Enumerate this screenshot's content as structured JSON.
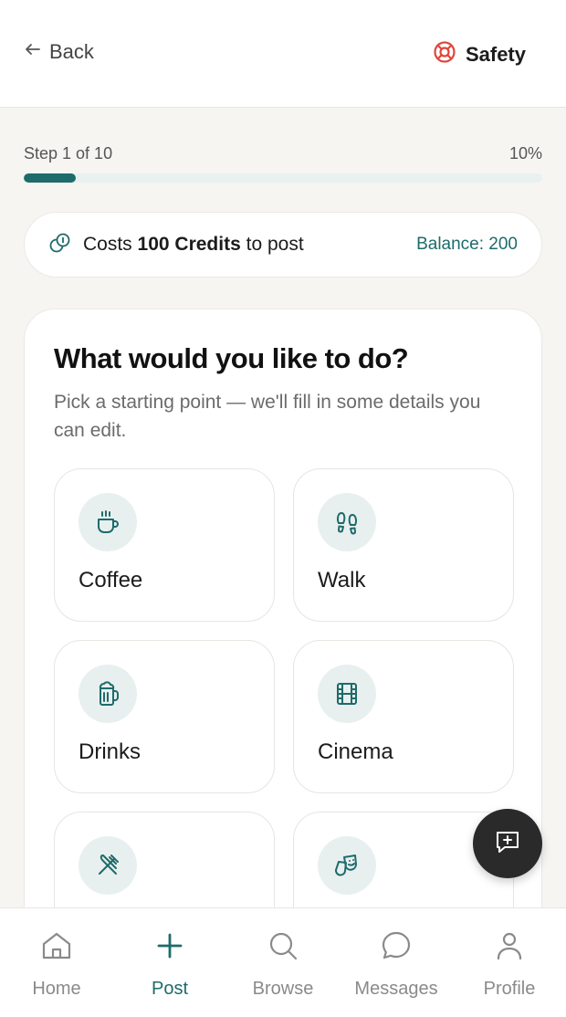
{
  "header": {
    "back_label": "Back",
    "safety_label": "Safety"
  },
  "progress": {
    "step_text": "Step 1 of 10",
    "percent_text": "10%",
    "value": 0.1
  },
  "credits": {
    "prefix": "Costs",
    "amount": "100 Credits",
    "suffix": "to post",
    "balance": "Balance: 200"
  },
  "main": {
    "title": "What would you like to do?",
    "subtitle": "Pick a starting point — we'll fill in some details you can edit.",
    "options": [
      {
        "label": "Coffee",
        "icon": "coffee-icon"
      },
      {
        "label": "Walk",
        "icon": "footprints-icon"
      },
      {
        "label": "Drinks",
        "icon": "beer-mug-icon"
      },
      {
        "label": "Cinema",
        "icon": "film-icon"
      },
      {
        "label": "",
        "icon": "utensils-icon"
      },
      {
        "label": "",
        "icon": "theater-mask-icon"
      }
    ]
  },
  "nav": {
    "items": [
      {
        "label": "Home",
        "icon": "home-icon",
        "active": false
      },
      {
        "label": "Post",
        "icon": "plus-icon",
        "active": true
      },
      {
        "label": "Browse",
        "icon": "search-icon",
        "active": false
      },
      {
        "label": "Messages",
        "icon": "chat-bubble-icon",
        "active": false
      },
      {
        "label": "Profile",
        "icon": "user-icon",
        "active": false
      }
    ]
  },
  "colors": {
    "accent": "#1e6b6b",
    "safety": "#e0463c",
    "fab": "#2a2a2a",
    "background": "#f6f5f2"
  }
}
